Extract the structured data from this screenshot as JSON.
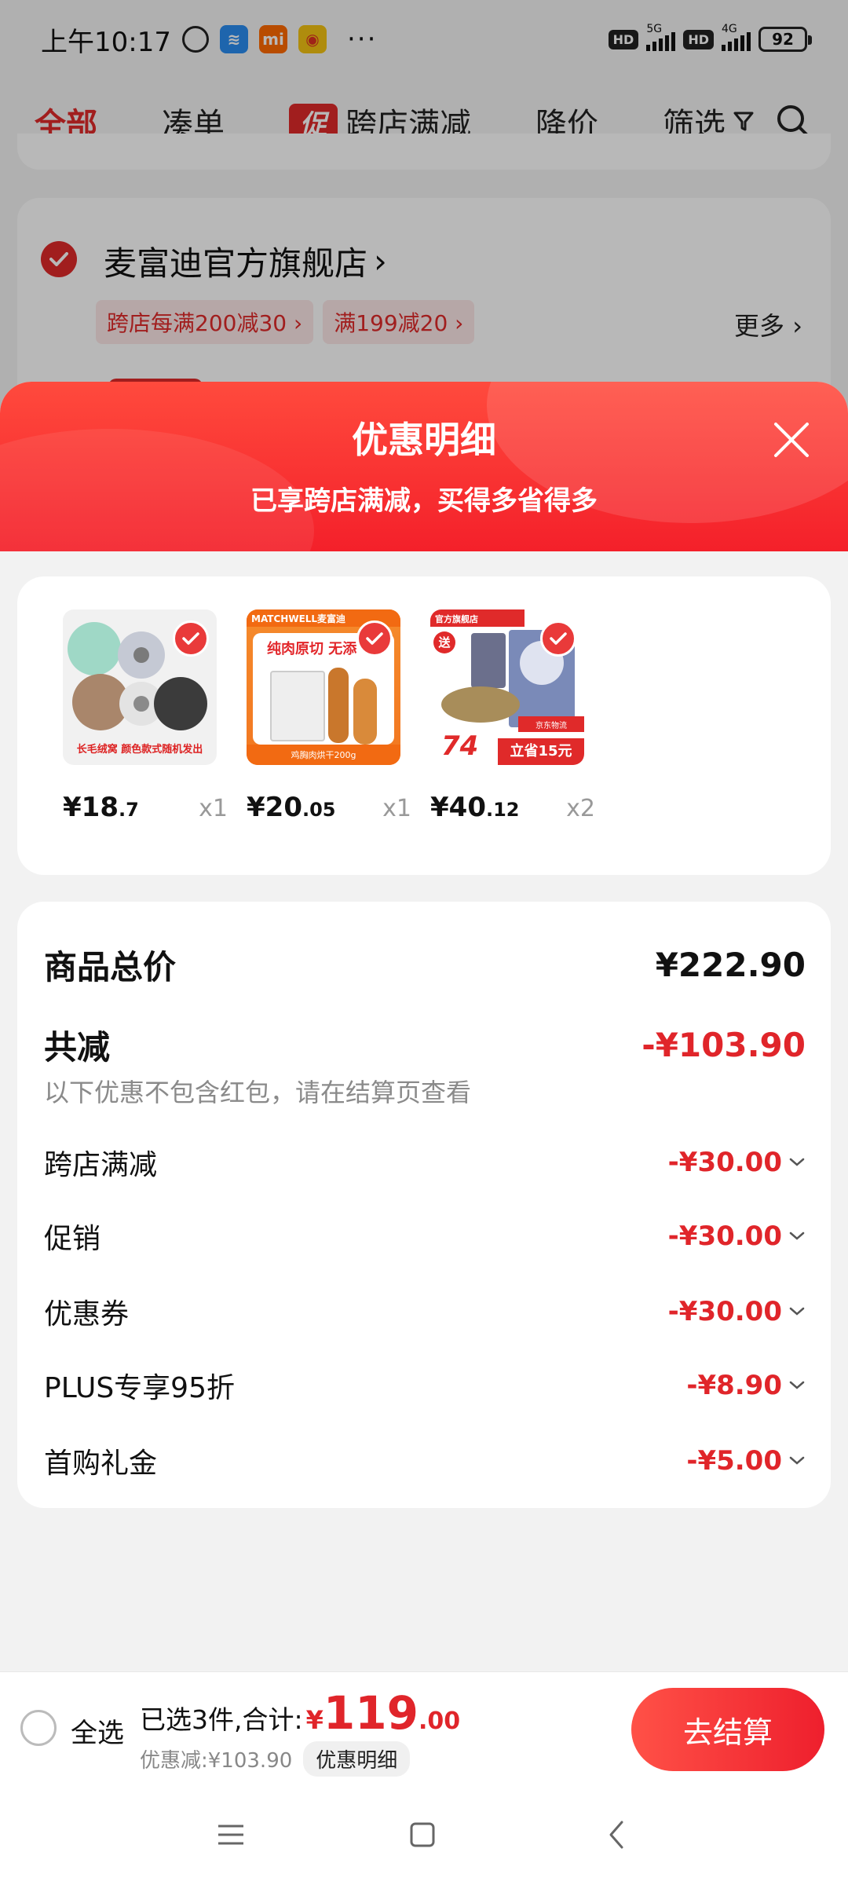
{
  "status_bar": {
    "time": "上午10:17",
    "network_1": "5G",
    "network_2": "4G",
    "hd": "HD",
    "battery": "92",
    "xiaomi_label": "mi"
  },
  "filter_bar": {
    "tabs": [
      {
        "label": "全部",
        "active": true
      },
      {
        "label": "凑单"
      },
      {
        "label": "跨店满减",
        "badge": "促"
      },
      {
        "label": "降价"
      },
      {
        "label": "筛选"
      }
    ]
  },
  "shop": {
    "name": "麦富迪官方旗舰店",
    "tags": [
      "跨店每满200减30",
      "满199减20"
    ],
    "more": "更多"
  },
  "sheet": {
    "title": "优惠明细",
    "subtitle": "已享跨店满减，买得多省得多"
  },
  "products": [
    {
      "price_int": "¥18",
      "price_dec": ".7",
      "qty": "x1",
      "image": "cat-bed"
    },
    {
      "price_int": "¥20",
      "price_dec": ".05",
      "qty": "x1",
      "image": "pet-jerky"
    },
    {
      "price_int": "¥40",
      "price_dec": ".12",
      "qty": "x2",
      "image": "cat-kibble"
    }
  ],
  "product_image_text": {
    "p1_caption": "长毛绒窝  颜色款式随机发出",
    "p2_brand": "MATCHWELL麦富迪",
    "p2_headline": "纯肉原切 无添",
    "p2_footer": "鸡胸肉烘干200g",
    "p3_store": "官方旗舰店",
    "p3_gift": "送",
    "p3_price": "74",
    "p3_save": "立省15元",
    "p3_logistics": "京东物流"
  },
  "summary": {
    "total_label": "商品总价",
    "total_value": "¥222.90",
    "discount_label": "共减",
    "discount_value": "-¥103.90",
    "note": "以下优惠不包含红包，请在结算页查看",
    "items": [
      {
        "label": "跨店满减",
        "value": "-¥30.00"
      },
      {
        "label": "促销",
        "value": "-¥30.00"
      },
      {
        "label": "优惠券",
        "value": "-¥30.00"
      },
      {
        "label": "PLUS专享95折",
        "value": "-¥8.90"
      },
      {
        "label": "首购礼金",
        "value": "-¥5.00"
      }
    ]
  },
  "bottom_bar": {
    "select_all": "全选",
    "selected_text": "已选3件,合计:",
    "currency": "¥",
    "total_int": "119",
    "total_dec": ".00",
    "saved_text": "优惠减:¥103.90",
    "detail_chip": "优惠明细",
    "checkout": "去结算"
  },
  "colors": {
    "accent": "#e0252a",
    "header_gradient_top": "#ff4a3d",
    "header_gradient_bottom": "#f4202a"
  }
}
